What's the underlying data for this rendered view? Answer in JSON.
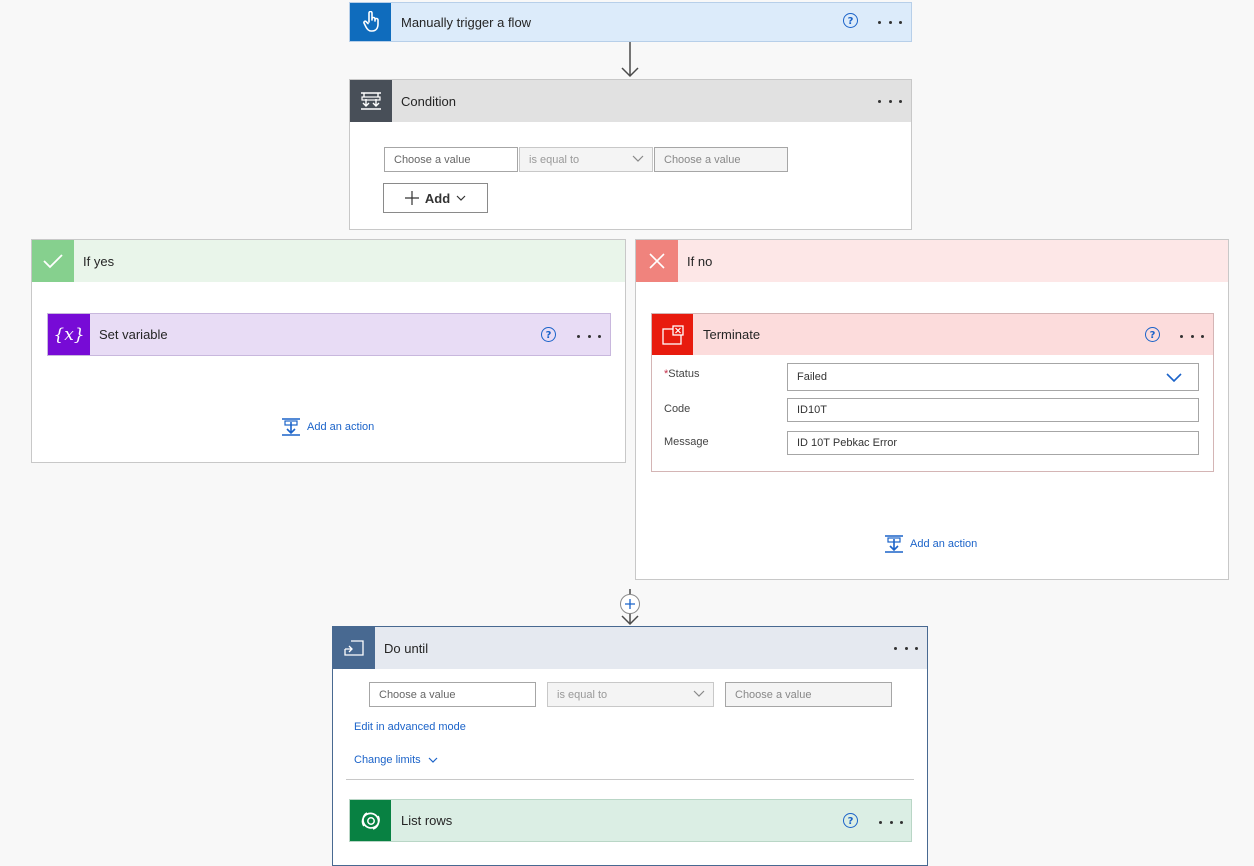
{
  "trigger": {
    "title": "Manually trigger a flow",
    "help": "?"
  },
  "condition": {
    "title": "Condition",
    "left_placeholder": "Choose a value",
    "operator": "is equal to",
    "right_placeholder": "Choose a value",
    "add_label": "Add"
  },
  "if_yes": {
    "title": "If yes",
    "action_title": "Set variable",
    "action_icon_text": "{x}",
    "help": "?",
    "add_action": "Add an action"
  },
  "if_no": {
    "title": "If no",
    "action_title": "Terminate",
    "help": "?",
    "fields": {
      "status_required_mark": "*",
      "status_label": "Status",
      "status_value": "Failed",
      "code_label": "Code",
      "code_value": "ID10T",
      "message_label": "Message",
      "message_value": "ID 10T Pebkac Error"
    },
    "add_action": "Add an action"
  },
  "do_until": {
    "title": "Do until",
    "left_placeholder": "Choose a value",
    "operator": "is equal to",
    "right_placeholder": "Choose a value",
    "advanced_link": "Edit in advanced mode",
    "change_limits": "Change limits"
  },
  "list_rows": {
    "title": "List rows",
    "help": "?"
  },
  "colors": {
    "trigger_accent": "#0f6cbd",
    "condition_accent": "#484f58",
    "yes_accent": "#86d08e",
    "no_accent": "#f0837d",
    "variable_accent": "#770bd6",
    "terminate_accent": "#e81b0e",
    "loop_accent": "#486991",
    "dataverse_accent": "#088142",
    "link": "#1b63c9"
  },
  "icons": {
    "trigger": "hand-pointer-icon",
    "condition": "condition-icon",
    "yes": "check-icon",
    "no": "close-icon",
    "variable": "variable-icon",
    "terminate": "terminate-icon",
    "add_action": "add-action-icon",
    "insert_step": "plus-circle-icon",
    "loop": "loop-icon",
    "dataverse": "dataverse-icon"
  }
}
